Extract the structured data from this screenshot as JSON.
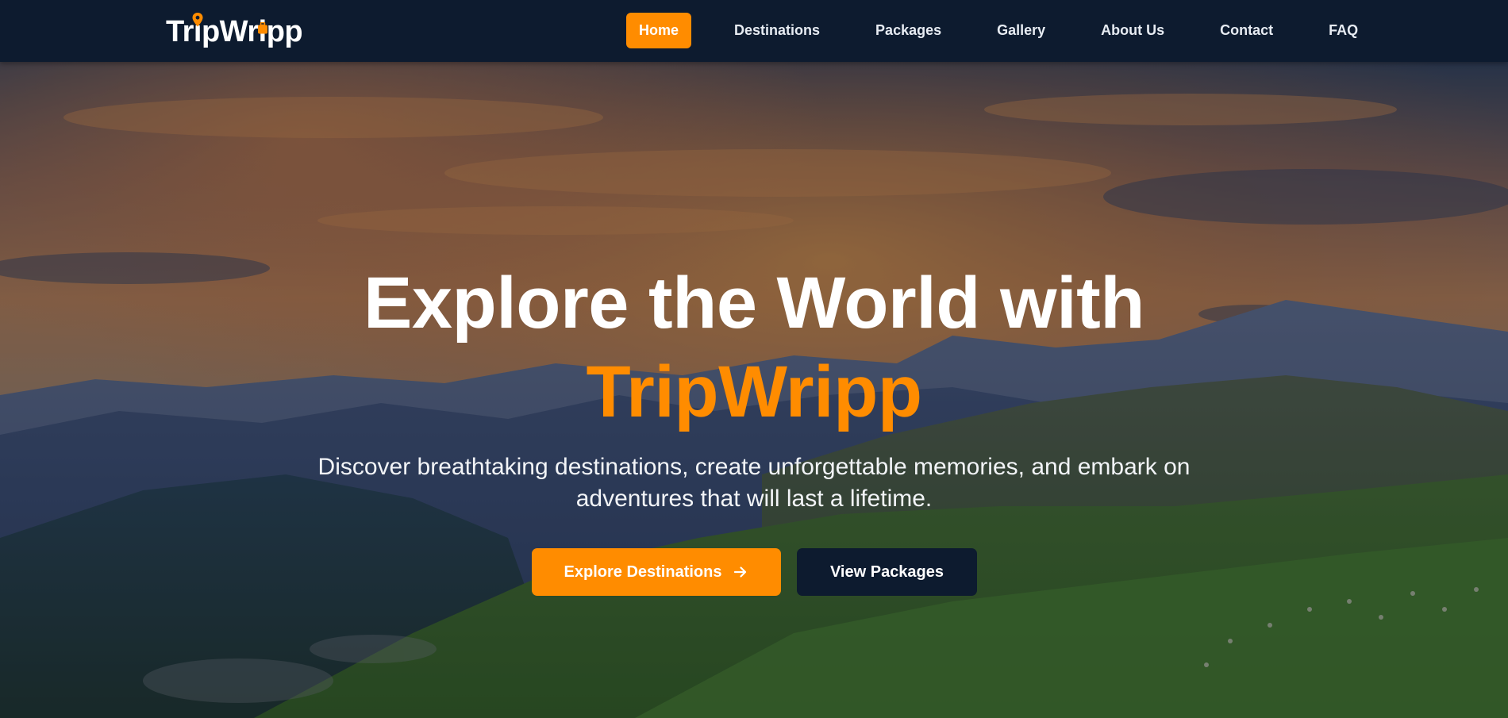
{
  "brand": {
    "logo_text": "TripWripp",
    "logo_icons": [
      "map-pin-icon",
      "suitcase-icon"
    ]
  },
  "nav": {
    "items": [
      {
        "label": "Home",
        "active": true
      },
      {
        "label": "Destinations",
        "active": false
      },
      {
        "label": "Packages",
        "active": false
      },
      {
        "label": "Gallery",
        "active": false
      },
      {
        "label": "About Us",
        "active": false
      },
      {
        "label": "Contact",
        "active": false
      },
      {
        "label": "FAQ",
        "active": false
      }
    ]
  },
  "hero": {
    "title_line1": "Explore the World with",
    "title_brand": "TripWripp",
    "subtitle": "Discover breathtaking destinations, create unforgettable memories, and embark on adventures that will last a lifetime.",
    "primary_button": "Explore Destinations",
    "primary_button_icon": "arrow-right-icon",
    "secondary_button": "View Packages"
  },
  "colors": {
    "accent": "#ff8c00",
    "navbar_bg": "#0d1b2f",
    "text_light": "#ffffff"
  }
}
